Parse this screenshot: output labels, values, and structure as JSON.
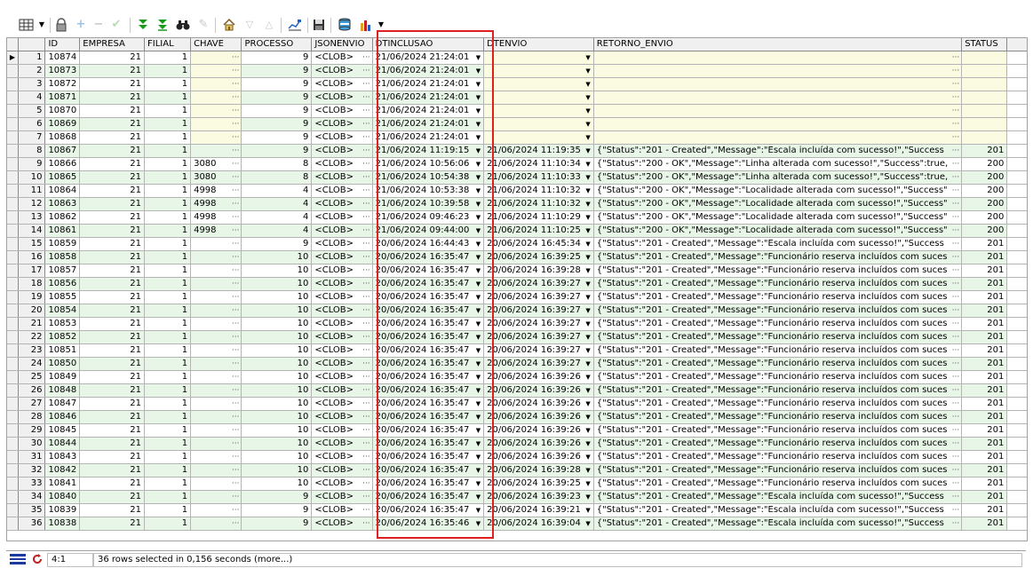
{
  "toolbar": {
    "icons": [
      "grid-icon",
      "dropdown-icon",
      "lock-icon",
      "add-icon",
      "remove-icon",
      "check-icon",
      "filter-down-icon",
      "filter-clear-icon",
      "binoculars-icon",
      "pencil-icon",
      "home-icon",
      "arrow-down-icon",
      "arrow-up-icon",
      "chart-icon",
      "save-icon",
      "database-icon",
      "chart-bar-icon"
    ]
  },
  "columns": [
    "ID",
    "EMPRESA",
    "FILIAL",
    "CHAVE",
    "PROCESSO",
    "JSONENVIO",
    "DTINCLUSAO",
    "DTENVIO",
    "RETORNO_ENVIO",
    "STATUS"
  ],
  "rows": [
    {
      "n": "1",
      "id": "10874",
      "emp": "21",
      "fil": "1",
      "key": "",
      "proc": "9",
      "json": "<CLOB>",
      "dtinc": "21/06/2024 21:24:01",
      "dtenv": "",
      "ret": "",
      "sts": ""
    },
    {
      "n": "2",
      "id": "10873",
      "emp": "21",
      "fil": "1",
      "key": "",
      "proc": "9",
      "json": "<CLOB>",
      "dtinc": "21/06/2024 21:24:01",
      "dtenv": "",
      "ret": "",
      "sts": ""
    },
    {
      "n": "3",
      "id": "10872",
      "emp": "21",
      "fil": "1",
      "key": "",
      "proc": "9",
      "json": "<CLOB>",
      "dtinc": "21/06/2024 21:24:01",
      "dtenv": "",
      "ret": "",
      "sts": ""
    },
    {
      "n": "4",
      "id": "10871",
      "emp": "21",
      "fil": "1",
      "key": "",
      "proc": "9",
      "json": "<CLOB>",
      "dtinc": "21/06/2024 21:24:01",
      "dtenv": "",
      "ret": "",
      "sts": ""
    },
    {
      "n": "5",
      "id": "10870",
      "emp": "21",
      "fil": "1",
      "key": "",
      "proc": "9",
      "json": "<CLOB>",
      "dtinc": "21/06/2024 21:24:01",
      "dtenv": "",
      "ret": "",
      "sts": ""
    },
    {
      "n": "6",
      "id": "10869",
      "emp": "21",
      "fil": "1",
      "key": "",
      "proc": "9",
      "json": "<CLOB>",
      "dtinc": "21/06/2024 21:24:01",
      "dtenv": "",
      "ret": "",
      "sts": ""
    },
    {
      "n": "7",
      "id": "10868",
      "emp": "21",
      "fil": "1",
      "key": "",
      "proc": "9",
      "json": "<CLOB>",
      "dtinc": "21/06/2024 21:24:01",
      "dtenv": "",
      "ret": "",
      "sts": ""
    },
    {
      "n": "8",
      "id": "10867",
      "emp": "21",
      "fil": "1",
      "key": "",
      "proc": "9",
      "json": "<CLOB>",
      "dtinc": "21/06/2024 11:19:15",
      "dtenv": "21/06/2024 11:19:35",
      "ret": "{\"Status\":\"201 - Created\",\"Message\":\"Escala incluída com sucesso!\",\"Success",
      "sts": "201"
    },
    {
      "n": "9",
      "id": "10866",
      "emp": "21",
      "fil": "1",
      "key": "3080",
      "proc": "8",
      "json": "<CLOB>",
      "dtinc": "21/06/2024 10:56:06",
      "dtenv": "21/06/2024 11:10:34",
      "ret": "{\"Status\":\"200 - OK\",\"Message\":\"Linha alterada com sucesso!\",\"Success\":true,",
      "sts": "200"
    },
    {
      "n": "10",
      "id": "10865",
      "emp": "21",
      "fil": "1",
      "key": "3080",
      "proc": "8",
      "json": "<CLOB>",
      "dtinc": "21/06/2024 10:54:38",
      "dtenv": "21/06/2024 11:10:33",
      "ret": "{\"Status\":\"200 - OK\",\"Message\":\"Linha alterada com sucesso!\",\"Success\":true,",
      "sts": "200"
    },
    {
      "n": "11",
      "id": "10864",
      "emp": "21",
      "fil": "1",
      "key": "4998",
      "proc": "4",
      "json": "<CLOB>",
      "dtinc": "21/06/2024 10:53:38",
      "dtenv": "21/06/2024 11:10:32",
      "ret": "{\"Status\":\"200 - OK\",\"Message\":\"Localidade alterada com sucesso!\",\"Success\"",
      "sts": "200"
    },
    {
      "n": "12",
      "id": "10863",
      "emp": "21",
      "fil": "1",
      "key": "4998",
      "proc": "4",
      "json": "<CLOB>",
      "dtinc": "21/06/2024 10:39:58",
      "dtenv": "21/06/2024 11:10:32",
      "ret": "{\"Status\":\"200 - OK\",\"Message\":\"Localidade alterada com sucesso!\",\"Success\"",
      "sts": "200"
    },
    {
      "n": "13",
      "id": "10862",
      "emp": "21",
      "fil": "1",
      "key": "4998",
      "proc": "4",
      "json": "<CLOB>",
      "dtinc": "21/06/2024 09:46:23",
      "dtenv": "21/06/2024 11:10:29",
      "ret": "{\"Status\":\"200 - OK\",\"Message\":\"Localidade alterada com sucesso!\",\"Success\"",
      "sts": "200"
    },
    {
      "n": "14",
      "id": "10861",
      "emp": "21",
      "fil": "1",
      "key": "4998",
      "proc": "4",
      "json": "<CLOB>",
      "dtinc": "21/06/2024 09:44:00",
      "dtenv": "21/06/2024 11:10:25",
      "ret": "{\"Status\":\"200 - OK\",\"Message\":\"Localidade alterada com sucesso!\",\"Success\"",
      "sts": "200"
    },
    {
      "n": "15",
      "id": "10859",
      "emp": "21",
      "fil": "1",
      "key": "",
      "proc": "9",
      "json": "<CLOB>",
      "dtinc": "20/06/2024 16:44:43",
      "dtenv": "20/06/2024 16:45:34",
      "ret": "{\"Status\":\"201 - Created\",\"Message\":\"Escala incluída com sucesso!\",\"Success",
      "sts": "201"
    },
    {
      "n": "16",
      "id": "10858",
      "emp": "21",
      "fil": "1",
      "key": "",
      "proc": "10",
      "json": "<CLOB>",
      "dtinc": "20/06/2024 16:35:47",
      "dtenv": "20/06/2024 16:39:25",
      "ret": "{\"Status\":\"201 - Created\",\"Message\":\"Funcionário reserva incluídos com suces",
      "sts": "201"
    },
    {
      "n": "17",
      "id": "10857",
      "emp": "21",
      "fil": "1",
      "key": "",
      "proc": "10",
      "json": "<CLOB>",
      "dtinc": "20/06/2024 16:35:47",
      "dtenv": "20/06/2024 16:39:28",
      "ret": "{\"Status\":\"201 - Created\",\"Message\":\"Funcionário reserva incluídos com suces",
      "sts": "201"
    },
    {
      "n": "18",
      "id": "10856",
      "emp": "21",
      "fil": "1",
      "key": "",
      "proc": "10",
      "json": "<CLOB>",
      "dtinc": "20/06/2024 16:35:47",
      "dtenv": "20/06/2024 16:39:27",
      "ret": "{\"Status\":\"201 - Created\",\"Message\":\"Funcionário reserva incluídos com suces",
      "sts": "201"
    },
    {
      "n": "19",
      "id": "10855",
      "emp": "21",
      "fil": "1",
      "key": "",
      "proc": "10",
      "json": "<CLOB>",
      "dtinc": "20/06/2024 16:35:47",
      "dtenv": "20/06/2024 16:39:27",
      "ret": "{\"Status\":\"201 - Created\",\"Message\":\"Funcionário reserva incluídos com suces",
      "sts": "201"
    },
    {
      "n": "20",
      "id": "10854",
      "emp": "21",
      "fil": "1",
      "key": "",
      "proc": "10",
      "json": "<CLOB>",
      "dtinc": "20/06/2024 16:35:47",
      "dtenv": "20/06/2024 16:39:27",
      "ret": "{\"Status\":\"201 - Created\",\"Message\":\"Funcionário reserva incluídos com suces",
      "sts": "201"
    },
    {
      "n": "21",
      "id": "10853",
      "emp": "21",
      "fil": "1",
      "key": "",
      "proc": "10",
      "json": "<CLOB>",
      "dtinc": "20/06/2024 16:35:47",
      "dtenv": "20/06/2024 16:39:27",
      "ret": "{\"Status\":\"201 - Created\",\"Message\":\"Funcionário reserva incluídos com suces",
      "sts": "201"
    },
    {
      "n": "22",
      "id": "10852",
      "emp": "21",
      "fil": "1",
      "key": "",
      "proc": "10",
      "json": "<CLOB>",
      "dtinc": "20/06/2024 16:35:47",
      "dtenv": "20/06/2024 16:39:27",
      "ret": "{\"Status\":\"201 - Created\",\"Message\":\"Funcionário reserva incluídos com suces",
      "sts": "201"
    },
    {
      "n": "23",
      "id": "10851",
      "emp": "21",
      "fil": "1",
      "key": "",
      "proc": "10",
      "json": "<CLOB>",
      "dtinc": "20/06/2024 16:35:47",
      "dtenv": "20/06/2024 16:39:27",
      "ret": "{\"Status\":\"201 - Created\",\"Message\":\"Funcionário reserva incluídos com suces",
      "sts": "201"
    },
    {
      "n": "24",
      "id": "10850",
      "emp": "21",
      "fil": "1",
      "key": "",
      "proc": "10",
      "json": "<CLOB>",
      "dtinc": "20/06/2024 16:35:47",
      "dtenv": "20/06/2024 16:39:27",
      "ret": "{\"Status\":\"201 - Created\",\"Message\":\"Funcionário reserva incluídos com suces",
      "sts": "201"
    },
    {
      "n": "25",
      "id": "10849",
      "emp": "21",
      "fil": "1",
      "key": "",
      "proc": "10",
      "json": "<CLOB>",
      "dtinc": "20/06/2024 16:35:47",
      "dtenv": "20/06/2024 16:39:26",
      "ret": "{\"Status\":\"201 - Created\",\"Message\":\"Funcionário reserva incluídos com suces",
      "sts": "201"
    },
    {
      "n": "26",
      "id": "10848",
      "emp": "21",
      "fil": "1",
      "key": "",
      "proc": "10",
      "json": "<CLOB>",
      "dtinc": "20/06/2024 16:35:47",
      "dtenv": "20/06/2024 16:39:26",
      "ret": "{\"Status\":\"201 - Created\",\"Message\":\"Funcionário reserva incluídos com suces",
      "sts": "201"
    },
    {
      "n": "27",
      "id": "10847",
      "emp": "21",
      "fil": "1",
      "key": "",
      "proc": "10",
      "json": "<CLOB>",
      "dtinc": "20/06/2024 16:35:47",
      "dtenv": "20/06/2024 16:39:26",
      "ret": "{\"Status\":\"201 - Created\",\"Message\":\"Funcionário reserva incluídos com suces",
      "sts": "201"
    },
    {
      "n": "28",
      "id": "10846",
      "emp": "21",
      "fil": "1",
      "key": "",
      "proc": "10",
      "json": "<CLOB>",
      "dtinc": "20/06/2024 16:35:47",
      "dtenv": "20/06/2024 16:39:26",
      "ret": "{\"Status\":\"201 - Created\",\"Message\":\"Funcionário reserva incluídos com suces",
      "sts": "201"
    },
    {
      "n": "29",
      "id": "10845",
      "emp": "21",
      "fil": "1",
      "key": "",
      "proc": "10",
      "json": "<CLOB>",
      "dtinc": "20/06/2024 16:35:47",
      "dtenv": "20/06/2024 16:39:26",
      "ret": "{\"Status\":\"201 - Created\",\"Message\":\"Funcionário reserva incluídos com suces",
      "sts": "201"
    },
    {
      "n": "30",
      "id": "10844",
      "emp": "21",
      "fil": "1",
      "key": "",
      "proc": "10",
      "json": "<CLOB>",
      "dtinc": "20/06/2024 16:35:47",
      "dtenv": "20/06/2024 16:39:26",
      "ret": "{\"Status\":\"201 - Created\",\"Message\":\"Funcionário reserva incluídos com suces",
      "sts": "201"
    },
    {
      "n": "31",
      "id": "10843",
      "emp": "21",
      "fil": "1",
      "key": "",
      "proc": "10",
      "json": "<CLOB>",
      "dtinc": "20/06/2024 16:35:47",
      "dtenv": "20/06/2024 16:39:26",
      "ret": "{\"Status\":\"201 - Created\",\"Message\":\"Funcionário reserva incluídos com suces",
      "sts": "201"
    },
    {
      "n": "32",
      "id": "10842",
      "emp": "21",
      "fil": "1",
      "key": "",
      "proc": "10",
      "json": "<CLOB>",
      "dtinc": "20/06/2024 16:35:47",
      "dtenv": "20/06/2024 16:39:28",
      "ret": "{\"Status\":\"201 - Created\",\"Message\":\"Funcionário reserva incluídos com suces",
      "sts": "201"
    },
    {
      "n": "33",
      "id": "10841",
      "emp": "21",
      "fil": "1",
      "key": "",
      "proc": "10",
      "json": "<CLOB>",
      "dtinc": "20/06/2024 16:35:47",
      "dtenv": "20/06/2024 16:39:25",
      "ret": "{\"Status\":\"201 - Created\",\"Message\":\"Funcionário reserva incluídos com suces",
      "sts": "201"
    },
    {
      "n": "34",
      "id": "10840",
      "emp": "21",
      "fil": "1",
      "key": "",
      "proc": "9",
      "json": "<CLOB>",
      "dtinc": "20/06/2024 16:35:47",
      "dtenv": "20/06/2024 16:39:23",
      "ret": "{\"Status\":\"201 - Created\",\"Message\":\"Escala incluída com sucesso!\",\"Success",
      "sts": "201"
    },
    {
      "n": "35",
      "id": "10839",
      "emp": "21",
      "fil": "1",
      "key": "",
      "proc": "9",
      "json": "<CLOB>",
      "dtinc": "20/06/2024 16:35:47",
      "dtenv": "20/06/2024 16:39:21",
      "ret": "{\"Status\":\"201 - Created\",\"Message\":\"Escala incluída com sucesso!\",\"Success",
      "sts": "201"
    },
    {
      "n": "36",
      "id": "10838",
      "emp": "21",
      "fil": "1",
      "key": "",
      "proc": "9",
      "json": "<CLOB>",
      "dtinc": "20/06/2024 16:35:46",
      "dtenv": "20/06/2024 16:39:04",
      "ret": "{\"Status\":\"201 - Created\",\"Message\":\"Escala incluída com sucesso!\",\"Success",
      "sts": "201"
    }
  ],
  "statusbar": {
    "position": "4:1",
    "message": "36 rows selected in 0,156 seconds (more...)"
  },
  "colors": {
    "row_alt": "#e8f6e8",
    "row_pending": "#fbfbe1",
    "highlight_box": "#e02020"
  }
}
